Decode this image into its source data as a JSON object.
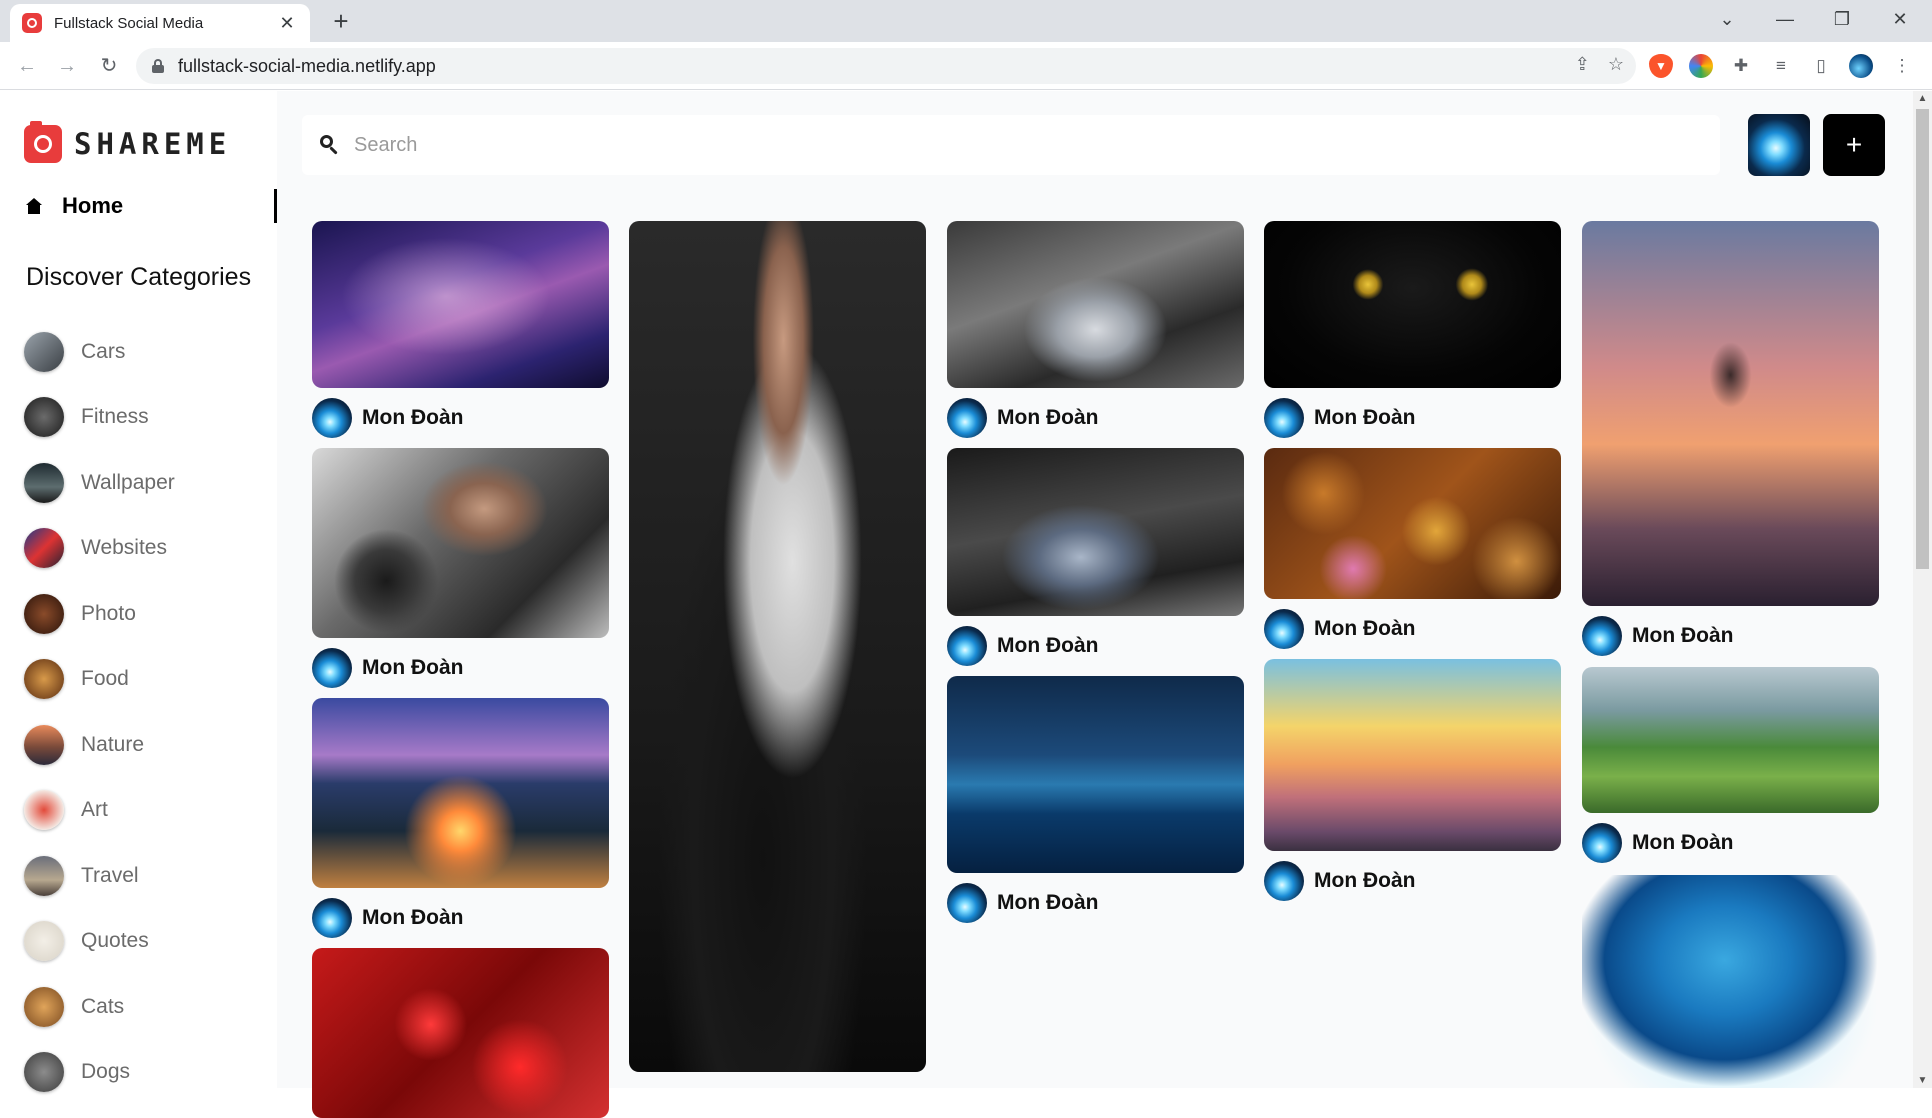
{
  "browser": {
    "tab_title": "Fullstack Social Media",
    "tab_close": "✕",
    "new_tab": "+",
    "url": "fullstack-social-media.netlify.app",
    "window_controls": [
      "⌄",
      "—",
      "❐",
      "✕"
    ]
  },
  "app": {
    "logo_text": "SHAREME",
    "nav": {
      "home_label": "Home"
    },
    "categories_heading": "Discover Categories",
    "categories": [
      {
        "label": "Cars",
        "thumb": "linear-gradient(135deg,#9aa3ab,#3a3f44)"
      },
      {
        "label": "Fitness",
        "thumb": "radial-gradient(circle,#6b6b6b,#1a1a1a)"
      },
      {
        "label": "Wallpaper",
        "thumb": "linear-gradient(180deg,#1e2a30,#5d6d6f 60%,#1a1a1a)"
      },
      {
        "label": "Websites",
        "thumb": "linear-gradient(135deg,#1b3a8a,#d33,#223)"
      },
      {
        "label": "Photo",
        "thumb": "radial-gradient(circle,#8a4b2a,#2a130a)"
      },
      {
        "label": "Food",
        "thumb": "radial-gradient(circle,#d89a4a,#5a2c10)"
      },
      {
        "label": "Nature",
        "thumb": "linear-gradient(180deg,#e98a5b,#7a4a3a 55%,#2b2a3a)"
      },
      {
        "label": "Art",
        "thumb": "radial-gradient(circle,#e24a3a,#f4e8e2 70%)"
      },
      {
        "label": "Travel",
        "thumb": "linear-gradient(180deg,#6a6e7a,#b7a88f 60%,#4a3f3a)"
      },
      {
        "label": "Quotes",
        "thumb": "radial-gradient(circle,#f3efe7,#d8d2c6)"
      },
      {
        "label": "Cats",
        "thumb": "radial-gradient(circle,#e0a45a,#7a4a20)"
      },
      {
        "label": "Dogs",
        "thumb": "radial-gradient(circle,#8c8c8c,#3b3b3b)"
      }
    ]
  },
  "search": {
    "placeholder": "Search",
    "value": ""
  },
  "add_button": {
    "label": "+"
  },
  "pins": [
    {
      "author": "Mon Đoàn",
      "has_footer": true,
      "image": "radial-gradient(ellipse at 45% 45%,rgba(255,210,240,0.55),transparent 45%),linear-gradient(160deg,#1a1550,#5a3a9a 40%,#9a5ab0 55%,#2c2370 80%,#0f0c2e)"
    },
    {
      "author": "Mon Đoàn",
      "has_footer": true,
      "image": "radial-gradient(ellipse at 58% 32%,#c49a80 0,#8a6450 14%,transparent 26%),radial-gradient(circle at 25% 70%,#1a1a1a 0,#3a3a3a 12%,transparent 20%),linear-gradient(135deg,#d9d9d9,#6a6a6a 40%,#2a2a2a 75%,#bdbdbd)"
    },
    {
      "author": "Mon Đoàn",
      "has_footer": true,
      "image": "radial-gradient(circle at 50% 70%,#ffd76b 0,#ff8a3a 10%,transparent 28%),linear-gradient(180deg,#3a4aa0 0,#a77ac8 30%,#2a3c6a 45%,#1a2a3a 70%,#c08040 100%)"
    },
    {
      "author": "",
      "has_footer": false,
      "image": "radial-gradient(circle at 40% 45%,#ff3a3a 0,transparent 18%),radial-gradient(circle at 70% 70%,#ff2a2a 0,transparent 20%),linear-gradient(135deg,#c61a1a,#7a0808 50%,#d43030)"
    },
    {
      "author": "",
      "has_footer": false,
      "image": "radial-gradient(ellipse at 52% 14%,#c79a80 0,#8a624e 9%,transparent 14%),radial-gradient(ellipse at 55% 40%,#e0e0e0 0,#bfbfbf 18%,transparent 30%),radial-gradient(ellipse at 45% 75%,#111 0,#1a1a1a 30%,transparent 45%),linear-gradient(180deg,#2a2a2a,#1a1a1a 60%,#0a0a0a)"
    },
    {
      "author": "Mon Đoàn",
      "has_footer": true,
      "image": "radial-gradient(ellipse at 50% 65%,#d8dbe0 0,#9aa0a8 18%,transparent 34%),linear-gradient(160deg,#3a3a3a,#7a7a7a 40%,#2a2a2a 70%,#6a6a6a)"
    },
    {
      "author": "Mon Đoàn",
      "has_footer": true,
      "image": "radial-gradient(ellipse at 45% 65%,#a9b6c8 0,#5c6a80 18%,transparent 34%),linear-gradient(170deg,#1a1a1a,#4a4a4a 45%,#202020 75%,#777)"
    },
    {
      "author": "Mon Đoàn",
      "has_footer": true,
      "image": "linear-gradient(180deg,#0f2a4a 0,#1c4a7a 40%,#2a7ab0 55%,#0a3a6a 70%,#052040 100%)"
    },
    {
      "author": "Mon Đoàn",
      "has_footer": true,
      "image": "radial-gradient(circle at 70% 38%,#e9c43a 0,#b08a1a 4%,transparent 7%),radial-gradient(circle at 35% 38%,#e9c43a 0,#b08a1a 4%,transparent 7%),radial-gradient(ellipse at 50% 40%,#1a1a1a,#050505 60%,#000)"
    },
    {
      "author": "Mon Đoàn",
      "has_footer": true,
      "image": "radial-gradient(circle at 20% 30%,#c87a2a 0,transparent 16%),radial-gradient(circle at 58% 55%,#e2a63a 0,transparent 18%),radial-gradient(circle at 30% 80%,#e07ab0 0,transparent 14%),radial-gradient(circle at 85% 75%,#d09040 0,transparent 16%),linear-gradient(135deg,#5a2a10,#a0541a 50%,#3a1a08)"
    },
    {
      "author": "Mon Đoàn",
      "has_footer": true,
      "image": "linear-gradient(180deg,#7ac0e0 0,#f4d46a 35%,#f0a060 55%,#c0707a 72%,#6a4a6a 90%,#3a3040 100%)"
    },
    {
      "author": "Mon Đoàn",
      "has_footer": true,
      "image": "radial-gradient(ellipse at 50% 40%,#3a2a2a 0,transparent 10%),linear-gradient(180deg,#6a7aa0 0,#d08a8a 38%,#f0a070 58%,#6a4a5a 80%,#2a2030 100%)"
    },
    {
      "author": "Mon Đoàn",
      "has_footer": true,
      "image": "linear-gradient(180deg,#b8c8d0 0,#7a9aa0 30%,#4a8a3a 55%,#7ab04a 75%,#3a6a2a 100%)"
    },
    {
      "author": "",
      "has_footer": false,
      "image": "radial-gradient(ellipse at 48% 40%,#3aa8e0 0,#1a7ac0 30%,#0a4a8a 55%,transparent 70%),radial-gradient(ellipse at 50% 60%,#bfefff 0,transparent 70%)"
    }
  ]
}
